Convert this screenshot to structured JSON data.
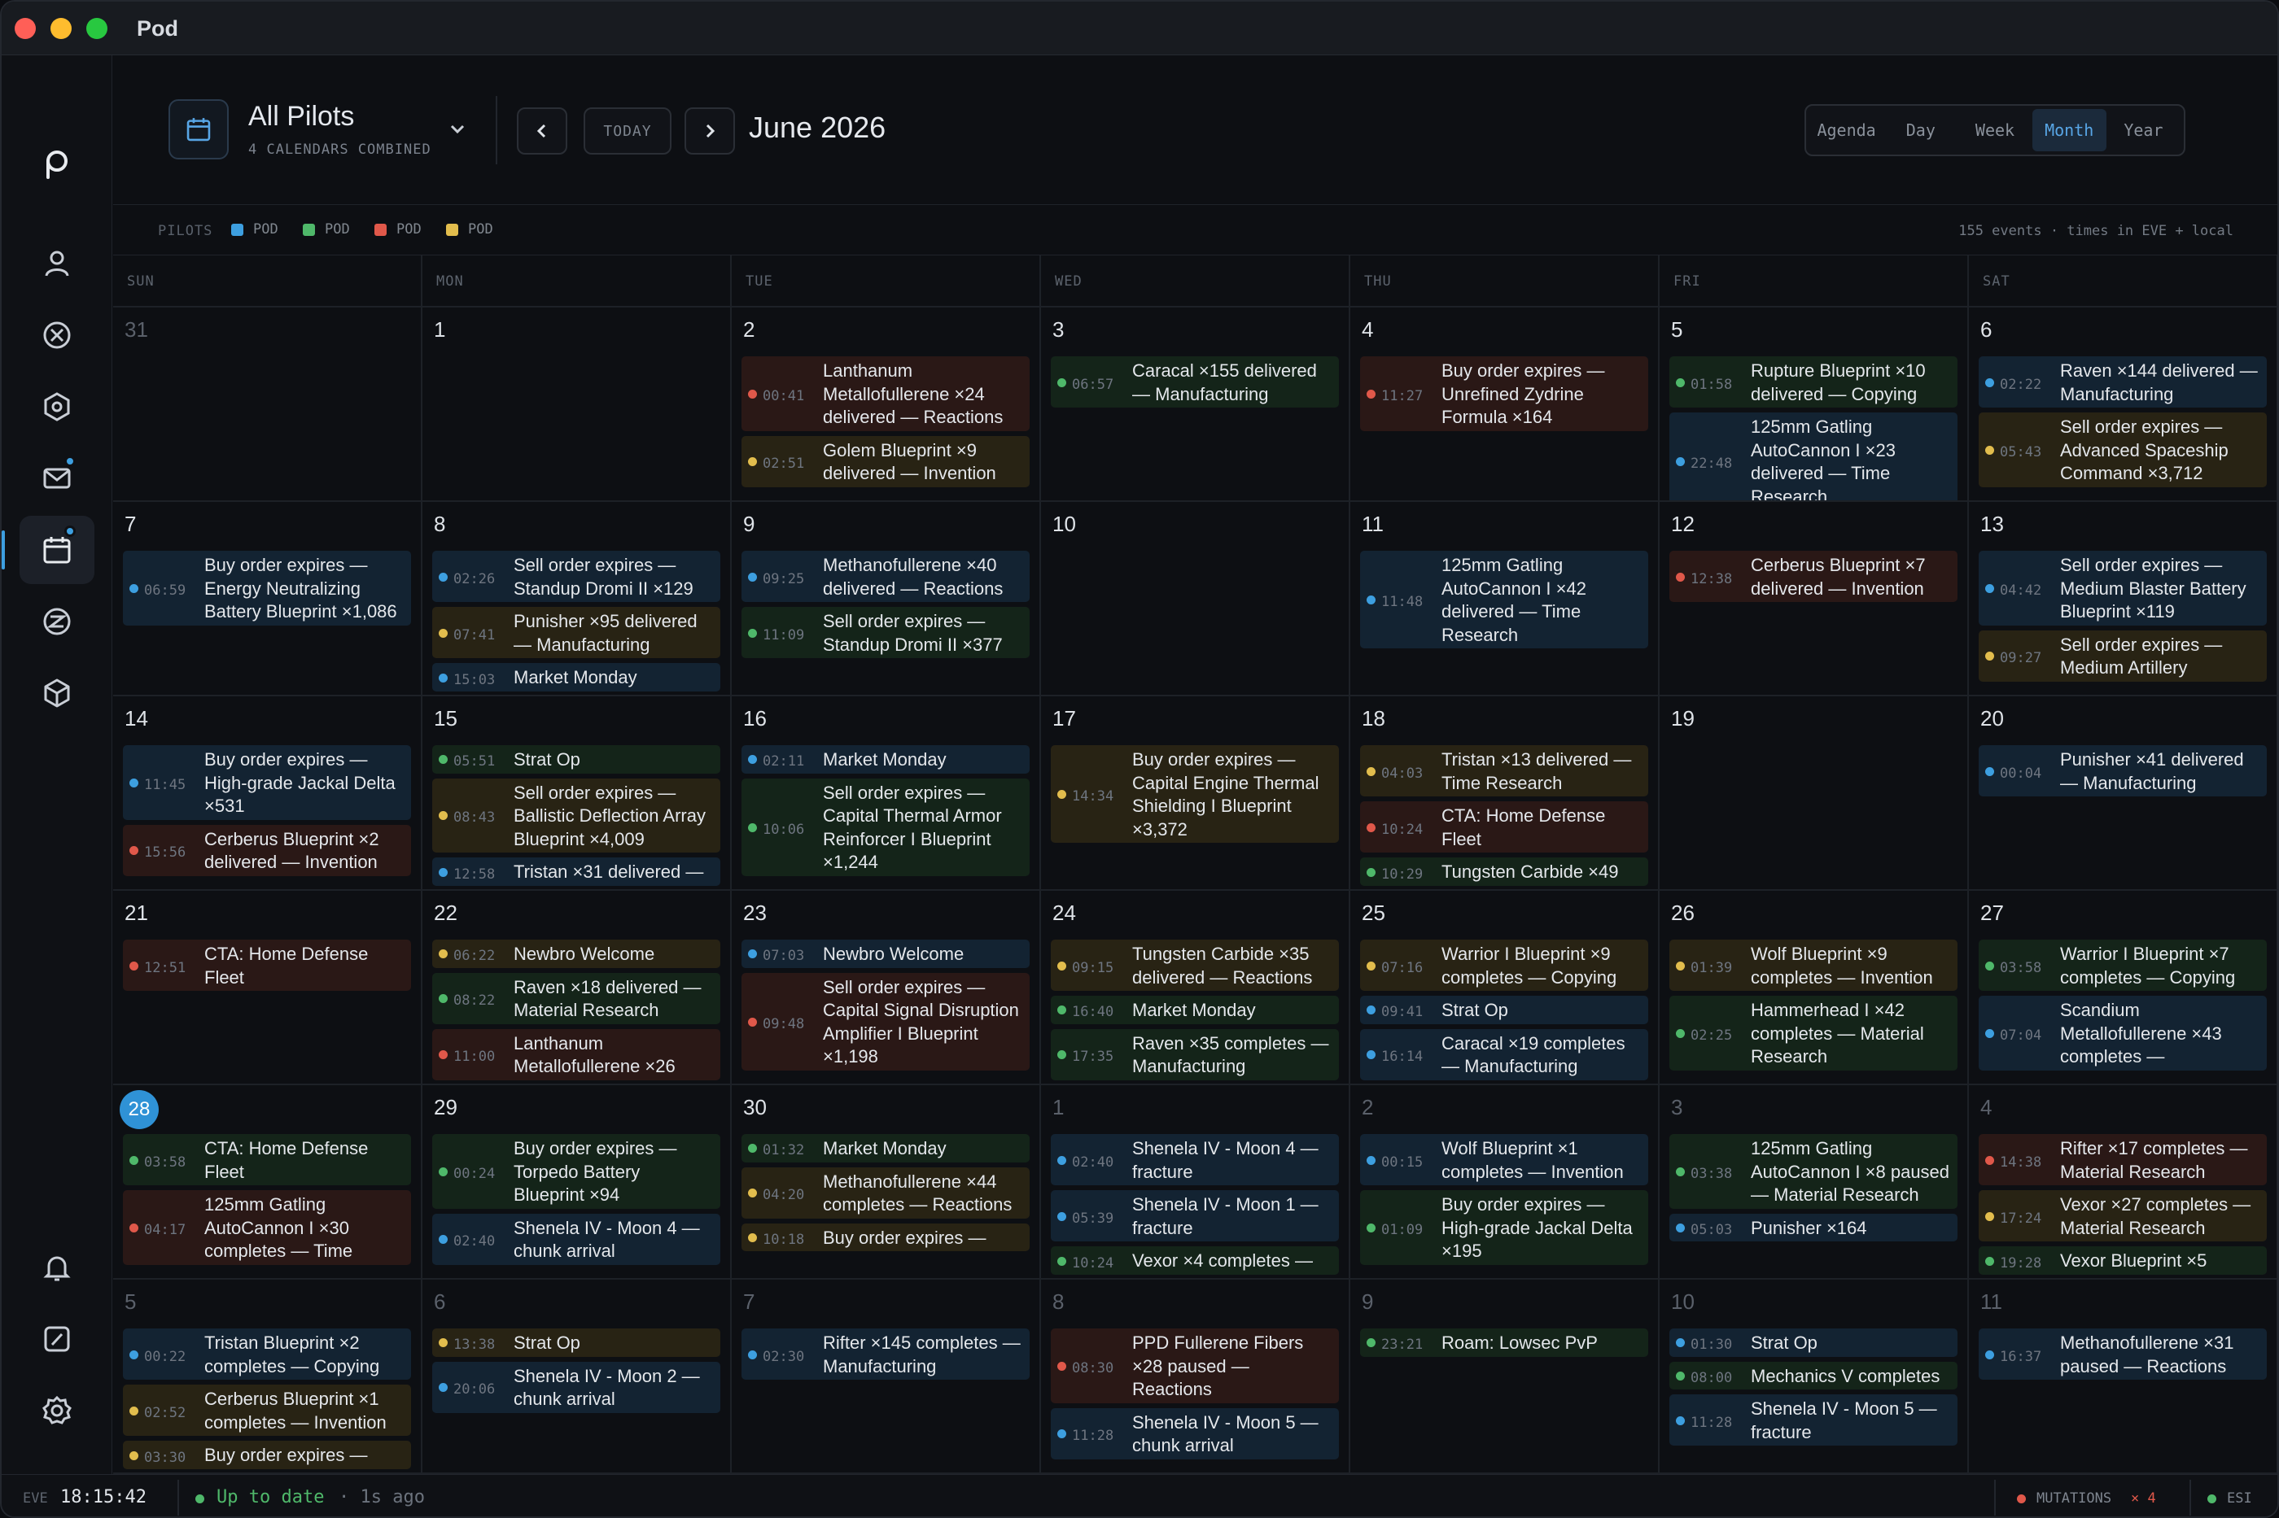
{
  "app": {
    "title": "Pod"
  },
  "colors": {
    "blue": "#3d9fe0",
    "green": "#4fb86a",
    "red": "#e0584a",
    "yellow": "#e2bd4d",
    "accent": "#58a6e6"
  },
  "sidebar": {
    "items": [
      {
        "icon": "logo-icon"
      },
      {
        "icon": "user-icon"
      },
      {
        "icon": "close-circle-icon"
      },
      {
        "icon": "settings-hex-icon"
      },
      {
        "icon": "mail-icon"
      },
      {
        "icon": "calendar-icon"
      },
      {
        "icon": "currency-icon"
      },
      {
        "icon": "cube-icon"
      },
      {
        "icon": "bell-icon"
      },
      {
        "icon": "gauge-icon"
      },
      {
        "icon": "gear-icon"
      }
    ]
  },
  "header": {
    "pilot_title": "All Pilots",
    "pilot_subtitle": "4 CALENDARS COMBINED",
    "today_label": "TODAY",
    "month_title": "June 2026",
    "views": [
      "Agenda",
      "Day",
      "Week",
      "Month",
      "Year"
    ],
    "active_view": "Month"
  },
  "legend": {
    "label": "PILOTS",
    "items": [
      {
        "name": "POD",
        "color": "#3d9fe0"
      },
      {
        "name": "POD",
        "color": "#4fb86a"
      },
      {
        "name": "POD",
        "color": "#e0584a"
      },
      {
        "name": "POD",
        "color": "#e2bd4d"
      }
    ],
    "summary": "155 events · times in EVE + local"
  },
  "calendar": {
    "weekdays": [
      "SUN",
      "MON",
      "TUE",
      "WED",
      "THU",
      "FRI",
      "SAT"
    ],
    "weeks": [
      [
        {
          "day": "31",
          "muted": true,
          "events": []
        },
        {
          "day": "1",
          "events": []
        },
        {
          "day": "2",
          "events": [
            {
              "time": "00:41",
              "color": "r",
              "text": "Lanthanum Metallofullerene ×24 delivered — Reactions"
            },
            {
              "time": "02:51",
              "color": "y",
              "text": "Golem Blueprint ×9 delivered — Invention"
            }
          ]
        },
        {
          "day": "3",
          "events": [
            {
              "time": "06:57",
              "color": "g",
              "text": "Caracal ×155 delivered — Manufacturing"
            }
          ]
        },
        {
          "day": "4",
          "events": [
            {
              "time": "11:27",
              "color": "r",
              "text": "Buy order expires — Unrefined Zydrine Formula ×164"
            }
          ]
        },
        {
          "day": "5",
          "events": [
            {
              "time": "01:58",
              "color": "g",
              "text": "Rupture Blueprint ×10 delivered — Copying"
            },
            {
              "time": "22:48",
              "color": "b",
              "text": "125mm Gatling AutoCannon I ×23 delivered — Time Research"
            }
          ]
        },
        {
          "day": "6",
          "events": [
            {
              "time": "02:22",
              "color": "b",
              "text": "Raven ×144 delivered — Manufacturing"
            },
            {
              "time": "05:43",
              "color": "y",
              "text": "Sell order expires — Advanced Spaceship Command ×3,712"
            }
          ]
        }
      ],
      [
        {
          "day": "7",
          "events": [
            {
              "time": "06:59",
              "color": "b",
              "text": "Buy order expires — Energy Neutralizing Battery Blueprint ×1,086"
            }
          ]
        },
        {
          "day": "8",
          "events": [
            {
              "time": "02:26",
              "color": "b",
              "text": "Sell order expires — Standup Dromi II ×129"
            },
            {
              "time": "07:41",
              "color": "y",
              "text": "Punisher ×95 delivered — Manufacturing"
            },
            {
              "time": "15:03",
              "color": "b",
              "text": "Market Monday"
            }
          ]
        },
        {
          "day": "9",
          "events": [
            {
              "time": "09:25",
              "color": "b",
              "text": "Methanofullerene ×40 delivered — Reactions"
            },
            {
              "time": "11:09",
              "color": "g",
              "text": "Sell order expires — Standup Dromi II ×377"
            }
          ]
        },
        {
          "day": "10",
          "events": []
        },
        {
          "day": "11",
          "events": [
            {
              "time": "11:48",
              "color": "b",
              "text": "125mm Gatling AutoCannon I ×42 delivered — Time Research"
            }
          ]
        },
        {
          "day": "12",
          "events": [
            {
              "time": "12:38",
              "color": "r",
              "text": "Cerberus Blueprint ×7 delivered — Invention"
            }
          ]
        },
        {
          "day": "13",
          "events": [
            {
              "time": "04:42",
              "color": "b",
              "text": "Sell order expires — Medium Blaster Battery Blueprint ×119"
            },
            {
              "time": "09:27",
              "color": "y",
              "text": "Sell order expires — Medium Artillery"
            }
          ]
        }
      ],
      [
        {
          "day": "14",
          "events": [
            {
              "time": "11:45",
              "color": "b",
              "text": "Buy order expires — High-grade Jackal Delta ×531"
            },
            {
              "time": "15:56",
              "color": "r",
              "text": "Cerberus Blueprint ×2 delivered — Invention"
            }
          ]
        },
        {
          "day": "15",
          "events": [
            {
              "time": "05:51",
              "color": "g",
              "text": "Strat Op"
            },
            {
              "time": "08:43",
              "color": "y",
              "text": "Sell order expires — Ballistic Deflection Array Blueprint ×4,009"
            },
            {
              "time": "12:58",
              "color": "b",
              "text": "Tristan ×31 delivered —"
            }
          ]
        },
        {
          "day": "16",
          "events": [
            {
              "time": "02:11",
              "color": "b",
              "text": "Market Monday"
            },
            {
              "time": "10:06",
              "color": "g",
              "text": "Sell order expires — Capital Thermal Armor Reinforcer I Blueprint ×1,244"
            }
          ]
        },
        {
          "day": "17",
          "events": [
            {
              "time": "14:34",
              "color": "y",
              "text": "Buy order expires — Capital Engine Thermal Shielding I Blueprint ×3,372"
            }
          ]
        },
        {
          "day": "18",
          "events": [
            {
              "time": "04:03",
              "color": "y",
              "text": "Tristan ×13 delivered — Time Research"
            },
            {
              "time": "10:24",
              "color": "r",
              "text": "CTA: Home Defense Fleet"
            },
            {
              "time": "10:29",
              "color": "g",
              "text": "Tungsten Carbide ×49"
            }
          ]
        },
        {
          "day": "19",
          "events": []
        },
        {
          "day": "20",
          "events": [
            {
              "time": "00:04",
              "color": "b",
              "text": "Punisher ×41 delivered — Manufacturing"
            }
          ]
        }
      ],
      [
        {
          "day": "21",
          "events": [
            {
              "time": "12:51",
              "color": "r",
              "text": "CTA: Home Defense Fleet"
            }
          ]
        },
        {
          "day": "22",
          "events": [
            {
              "time": "06:22",
              "color": "y",
              "text": "Newbro Welcome"
            },
            {
              "time": "08:22",
              "color": "g",
              "text": "Raven ×18 delivered — Material Research"
            },
            {
              "time": "11:00",
              "color": "r",
              "text": "Lanthanum Metallofullerene ×26"
            }
          ]
        },
        {
          "day": "23",
          "events": [
            {
              "time": "07:03",
              "color": "b",
              "text": "Newbro Welcome"
            },
            {
              "time": "09:48",
              "color": "r",
              "text": "Sell order expires — Capital Signal Disruption Amplifier I Blueprint ×1,198"
            }
          ]
        },
        {
          "day": "24",
          "events": [
            {
              "time": "09:15",
              "color": "y",
              "text": "Tungsten Carbide ×35 delivered — Reactions"
            },
            {
              "time": "16:40",
              "color": "g",
              "text": "Market Monday"
            },
            {
              "time": "17:35",
              "color": "g",
              "text": "Raven ×35 completes — Manufacturing"
            }
          ]
        },
        {
          "day": "25",
          "events": [
            {
              "time": "07:16",
              "color": "y",
              "text": "Warrior I Blueprint ×9 completes — Copying"
            },
            {
              "time": "09:41",
              "color": "b",
              "text": "Strat Op"
            },
            {
              "time": "16:14",
              "color": "b",
              "text": "Caracal ×19 completes — Manufacturing"
            }
          ]
        },
        {
          "day": "26",
          "events": [
            {
              "time": "01:39",
              "color": "y",
              "text": "Wolf Blueprint ×9 completes — Invention"
            },
            {
              "time": "02:25",
              "color": "g",
              "text": "Hammerhead I ×42 completes — Material Research"
            }
          ]
        },
        {
          "day": "27",
          "events": [
            {
              "time": "03:58",
              "color": "g",
              "text": "Warrior I Blueprint ×7 completes — Copying"
            },
            {
              "time": "07:04",
              "color": "b",
              "text": "Scandium Metallofullerene ×43 completes —"
            }
          ]
        }
      ],
      [
        {
          "day": "28",
          "today": true,
          "events": [
            {
              "time": "03:58",
              "color": "g",
              "text": "CTA: Home Defense Fleet"
            },
            {
              "time": "04:17",
              "color": "r",
              "text": "125mm Gatling AutoCannon I ×30 completes — Time"
            }
          ]
        },
        {
          "day": "29",
          "events": [
            {
              "time": "00:24",
              "color": "g",
              "text": "Buy order expires — Torpedo Battery Blueprint ×94"
            },
            {
              "time": "02:40",
              "color": "b",
              "text": "Shenela IV - Moon 4 — chunk arrival"
            }
          ]
        },
        {
          "day": "30",
          "events": [
            {
              "time": "01:32",
              "color": "g",
              "text": "Market Monday"
            },
            {
              "time": "04:20",
              "color": "y",
              "text": "Methanofullerene ×44 completes — Reactions"
            },
            {
              "time": "10:18",
              "color": "y",
              "text": "Buy order expires —"
            }
          ]
        },
        {
          "day": "1",
          "muted": true,
          "events": [
            {
              "time": "02:40",
              "color": "b",
              "text": "Shenela IV - Moon 4 — fracture"
            },
            {
              "time": "05:39",
              "color": "b",
              "text": "Shenela IV - Moon 1 — fracture"
            },
            {
              "time": "10:24",
              "color": "g",
              "text": "Vexor ×4 completes —"
            }
          ]
        },
        {
          "day": "2",
          "muted": true,
          "events": [
            {
              "time": "00:15",
              "color": "b",
              "text": "Wolf Blueprint ×1 completes — Invention"
            },
            {
              "time": "01:09",
              "color": "g",
              "text": "Buy order expires — High-grade Jackal Delta ×195"
            }
          ]
        },
        {
          "day": "3",
          "muted": true,
          "events": [
            {
              "time": "03:38",
              "color": "g",
              "text": "125mm Gatling AutoCannon I ×8 paused — Material Research"
            },
            {
              "time": "05:03",
              "color": "b",
              "text": "Punisher ×164"
            }
          ]
        },
        {
          "day": "4",
          "muted": true,
          "events": [
            {
              "time": "14:38",
              "color": "r",
              "text": "Rifter ×17 completes — Material Research"
            },
            {
              "time": "17:24",
              "color": "y",
              "text": "Vexor ×27 completes — Material Research"
            },
            {
              "time": "19:28",
              "color": "g",
              "text": "Vexor Blueprint ×5"
            }
          ]
        }
      ],
      [
        {
          "day": "5",
          "muted": true,
          "events": [
            {
              "time": "00:22",
              "color": "b",
              "text": "Tristan Blueprint ×2 completes — Copying"
            },
            {
              "time": "02:52",
              "color": "y",
              "text": "Cerberus Blueprint ×1 completes — Invention"
            },
            {
              "time": "03:30",
              "color": "y",
              "text": "Buy order expires —"
            }
          ]
        },
        {
          "day": "6",
          "muted": true,
          "events": [
            {
              "time": "13:38",
              "color": "y",
              "text": "Strat Op"
            },
            {
              "time": "20:06",
              "color": "b",
              "text": "Shenela IV - Moon 2 — chunk arrival"
            }
          ]
        },
        {
          "day": "7",
          "muted": true,
          "events": [
            {
              "time": "02:30",
              "color": "b",
              "text": "Rifter ×145 completes — Manufacturing"
            }
          ]
        },
        {
          "day": "8",
          "muted": true,
          "events": [
            {
              "time": "08:30",
              "color": "r",
              "text": "PPD Fullerene Fibers ×28 paused — Reactions"
            },
            {
              "time": "11:28",
              "color": "b",
              "text": "Shenela IV - Moon 5 — chunk arrival"
            }
          ]
        },
        {
          "day": "9",
          "muted": true,
          "events": [
            {
              "time": "23:21",
              "color": "g",
              "text": "Roam: Lowsec PvP"
            }
          ]
        },
        {
          "day": "10",
          "muted": true,
          "events": [
            {
              "time": "01:30",
              "color": "b",
              "text": "Strat Op"
            },
            {
              "time": "08:00",
              "color": "g",
              "text": "Mechanics V completes"
            },
            {
              "time": "11:28",
              "color": "b",
              "text": "Shenela IV - Moon 5 — fracture"
            }
          ]
        },
        {
          "day": "11",
          "muted": true,
          "events": [
            {
              "time": "16:37",
              "color": "b",
              "text": "Methanofullerene ×31 paused — Reactions"
            }
          ]
        }
      ]
    ]
  },
  "statusbar": {
    "eve_label": "EVE",
    "clock": "18:15:42",
    "sync_status": "Up to date",
    "sync_ago": "· 1s ago",
    "mutations_label": "MUTATIONS",
    "mutations_count": "× 4",
    "esi_label": "ESI"
  }
}
